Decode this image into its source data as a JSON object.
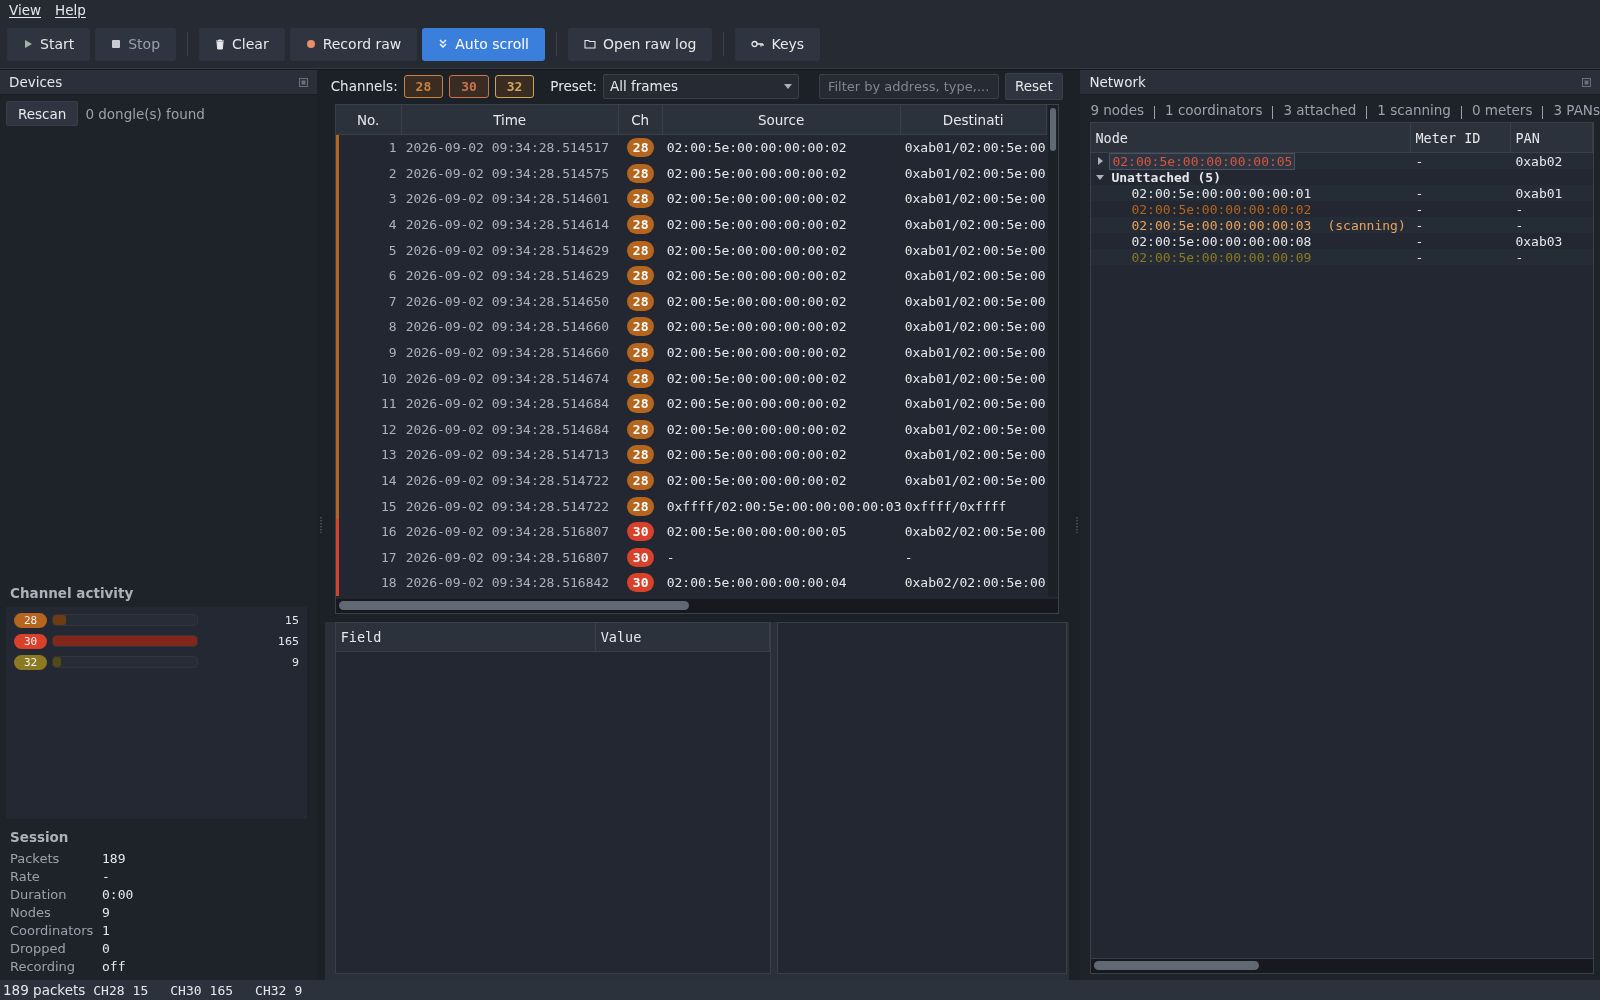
{
  "menu": [
    "View",
    "Help"
  ],
  "toolbar": [
    {
      "label": "Start",
      "kind": "play",
      "disabled": false,
      "selected": false
    },
    {
      "label": "Stop",
      "kind": "stop",
      "disabled": true,
      "selected": false
    },
    {
      "label": "Clear",
      "kind": "trash",
      "disabled": false,
      "selected": false
    },
    {
      "label": "Record raw",
      "kind": "record",
      "disabled": false,
      "selected": false
    },
    {
      "label": "Auto scroll",
      "kind": "scroll",
      "disabled": false,
      "selected": true
    },
    {
      "label": "Open raw log",
      "kind": "folder",
      "disabled": false,
      "selected": false
    },
    {
      "label": "Keys",
      "kind": "key",
      "disabled": false,
      "selected": false
    }
  ],
  "devices": {
    "title": "Devices",
    "rescan": "Rescan",
    "status": "0 dongle(s) found"
  },
  "channel_activity": {
    "title": "Channel activity",
    "channels": [
      {
        "channel": "28",
        "count": "15",
        "level": 0.09,
        "color": "#b5651d"
      },
      {
        "channel": "30",
        "count": "165",
        "level": 1.0,
        "color": "#d9412b"
      },
      {
        "channel": "32",
        "count": "9",
        "level": 0.055,
        "color": "#8c7a22"
      }
    ]
  },
  "session": {
    "title": "Session",
    "rows": [
      {
        "label": "Packets",
        "value": "189"
      },
      {
        "label": "Rate",
        "value": "-"
      },
      {
        "label": "Duration",
        "value": "0:00"
      },
      {
        "label": "Nodes",
        "value": "9"
      },
      {
        "label": "Coordinators",
        "value": "1"
      },
      {
        "label": "Dropped",
        "value": "0"
      },
      {
        "label": "Recording",
        "value": "off"
      }
    ]
  },
  "filters": {
    "channels_label": "Channels:",
    "channels": [
      {
        "label": "28",
        "selected": true,
        "color": "#c9823f"
      },
      {
        "label": "30",
        "selected": true,
        "color": "#c9734f"
      },
      {
        "label": "32",
        "selected": true,
        "color": "#c9a85a"
      }
    ],
    "preset_label": "Preset:",
    "preset": "All frames",
    "placeholder": "Filter by address, type,...",
    "reset": "Reset"
  },
  "packets": {
    "columns": [
      "No.",
      "Time",
      "Ch",
      "Source",
      "Destinati"
    ],
    "rows": [
      {
        "no": "1",
        "time": "2026-09-02 09:34:28.514517",
        "ch": "28",
        "color": "#b5651d",
        "source": "02:00:5e:00:00:00:00:02",
        "destination": "0xab01/02:00:5e:00"
      },
      {
        "no": "2",
        "time": "2026-09-02 09:34:28.514575",
        "ch": "28",
        "color": "#b5651d",
        "source": "02:00:5e:00:00:00:00:02",
        "destination": "0xab01/02:00:5e:00"
      },
      {
        "no": "3",
        "time": "2026-09-02 09:34:28.514601",
        "ch": "28",
        "color": "#b5651d",
        "source": "02:00:5e:00:00:00:00:02",
        "destination": "0xab01/02:00:5e:00"
      },
      {
        "no": "4",
        "time": "2026-09-02 09:34:28.514614",
        "ch": "28",
        "color": "#b5651d",
        "source": "02:00:5e:00:00:00:00:02",
        "destination": "0xab01/02:00:5e:00"
      },
      {
        "no": "5",
        "time": "2026-09-02 09:34:28.514629",
        "ch": "28",
        "color": "#b5651d",
        "source": "02:00:5e:00:00:00:00:02",
        "destination": "0xab01/02:00:5e:00"
      },
      {
        "no": "6",
        "time": "2026-09-02 09:34:28.514629",
        "ch": "28",
        "color": "#b5651d",
        "source": "02:00:5e:00:00:00:00:02",
        "destination": "0xab01/02:00:5e:00"
      },
      {
        "no": "7",
        "time": "2026-09-02 09:34:28.514650",
        "ch": "28",
        "color": "#b5651d",
        "source": "02:00:5e:00:00:00:00:02",
        "destination": "0xab01/02:00:5e:00"
      },
      {
        "no": "8",
        "time": "2026-09-02 09:34:28.514660",
        "ch": "28",
        "color": "#b5651d",
        "source": "02:00:5e:00:00:00:00:02",
        "destination": "0xab01/02:00:5e:00"
      },
      {
        "no": "9",
        "time": "2026-09-02 09:34:28.514660",
        "ch": "28",
        "color": "#b5651d",
        "source": "02:00:5e:00:00:00:00:02",
        "destination": "0xab01/02:00:5e:00"
      },
      {
        "no": "10",
        "time": "2026-09-02 09:34:28.514674",
        "ch": "28",
        "color": "#b5651d",
        "source": "02:00:5e:00:00:00:00:02",
        "destination": "0xab01/02:00:5e:00"
      },
      {
        "no": "11",
        "time": "2026-09-02 09:34:28.514684",
        "ch": "28",
        "color": "#b5651d",
        "source": "02:00:5e:00:00:00:00:02",
        "destination": "0xab01/02:00:5e:00"
      },
      {
        "no": "12",
        "time": "2026-09-02 09:34:28.514684",
        "ch": "28",
        "color": "#b5651d",
        "source": "02:00:5e:00:00:00:00:02",
        "destination": "0xab01/02:00:5e:00"
      },
      {
        "no": "13",
        "time": "2026-09-02 09:34:28.514713",
        "ch": "28",
        "color": "#b5651d",
        "source": "02:00:5e:00:00:00:00:02",
        "destination": "0xab01/02:00:5e:00"
      },
      {
        "no": "14",
        "time": "2026-09-02 09:34:28.514722",
        "ch": "28",
        "color": "#b5651d",
        "source": "02:00:5e:00:00:00:00:02",
        "destination": "0xab01/02:00:5e:00"
      },
      {
        "no": "15",
        "time": "2026-09-02 09:34:28.514722",
        "ch": "28",
        "color": "#b5651d",
        "source": "0xffff/02:00:5e:00:00:00:00:03",
        "destination": "0xffff/0xffff"
      },
      {
        "no": "16",
        "time": "2026-09-02 09:34:28.516807",
        "ch": "30",
        "color": "#d9412b",
        "source": "02:00:5e:00:00:00:00:05",
        "destination": "0xab02/02:00:5e:00"
      },
      {
        "no": "17",
        "time": "2026-09-02 09:34:28.516807",
        "ch": "30",
        "color": "#d9412b",
        "source": "-",
        "destination": "-"
      },
      {
        "no": "18",
        "time": "2026-09-02 09:34:28.516842",
        "ch": "30",
        "color": "#d9412b",
        "source": "02:00:5e:00:00:00:00:04",
        "destination": "0xab02/02:00:5e:00"
      }
    ]
  },
  "details": {
    "columns": [
      "Field",
      "Value"
    ]
  },
  "network": {
    "title": "Network",
    "summary": [
      "9 nodes",
      "1 coordinators",
      "3 attached",
      "1 scanning",
      "0 meters",
      "3 PANs"
    ],
    "columns": [
      "Node",
      "Meter ID",
      "PAN"
    ],
    "nodes": [
      {
        "node": "02:00:5e:00:00:00:00:05",
        "meter_id": "-",
        "pan": "0xab02",
        "expanded": false,
        "selected": true,
        "color": "#d9553a"
      },
      {
        "node": "Unattached (5)",
        "expanded": true,
        "selected": false,
        "children": [
          {
            "node": "02:00:5e:00:00:00:00:01",
            "meter_id": "-",
            "pan": "0xab01",
            "selected": false,
            "color": "#e6e8eb"
          },
          {
            "node": "02:00:5e:00:00:00:00:02",
            "meter_id": "-",
            "pan": "-",
            "selected": false,
            "color": "#b5651d"
          },
          {
            "node": "02:00:5e:00:00:00:00:03",
            "note": "(scanning)",
            "meter_id": "-",
            "pan": "-",
            "selected": false,
            "color": "#e8a15c"
          },
          {
            "node": "02:00:5e:00:00:00:00:08",
            "meter_id": "-",
            "pan": "0xab03",
            "selected": false,
            "color": "#e6e8eb"
          },
          {
            "node": "02:00:5e:00:00:00:00:09",
            "meter_id": "-",
            "pan": "-",
            "selected": false,
            "color": "#8c7a22"
          }
        ]
      }
    ]
  },
  "status_bar": {
    "packets": "189 packets",
    "channels": [
      {
        "label": "CH28",
        "count": "15"
      },
      {
        "label": "CH30",
        "count": "165"
      },
      {
        "label": "CH32",
        "count": "9"
      }
    ]
  }
}
